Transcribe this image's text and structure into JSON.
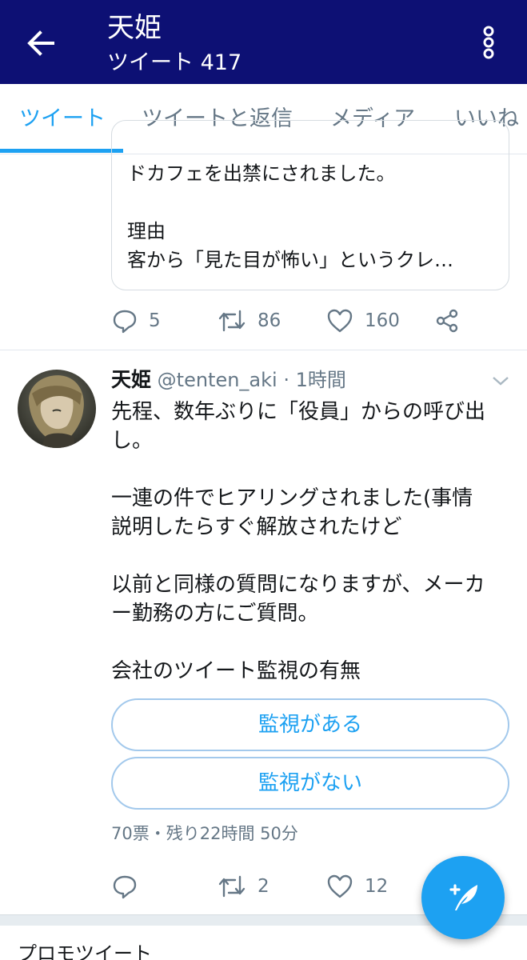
{
  "header": {
    "title": "天姫",
    "subtitle": "ツイート 417",
    "back_icon": "arrow-left-icon",
    "more_icon": "more-vertical-icon"
  },
  "tabs": [
    {
      "label": "ツイート",
      "active": true
    },
    {
      "label": "ツイートと返信",
      "active": false
    },
    {
      "label": "メディア",
      "active": false
    },
    {
      "label": "いいね",
      "active": false
    }
  ],
  "previous_tweet": {
    "text_lines": [
      "ドカフェを出禁にされました。",
      "",
      "理由",
      "客から「見た目が怖い」というクレ…"
    ],
    "replies": "5",
    "retweets": "86",
    "likes": "160"
  },
  "tweet": {
    "name": "天姫",
    "handle": "@tenten_aki",
    "time": "· 1時間",
    "text_lines": [
      "先程、数年ぶりに「役員」からの呼び出",
      "し。",
      "",
      "一連の件でヒアリングされました(事情",
      "説明したらすぐ解放されたけど",
      "",
      "以前と同様の質問になりますが、メーカ",
      "ー勤務の方にご質問。",
      "",
      "会社のツイート監視の有無"
    ],
    "poll_options": [
      "監視がある",
      "監視がない"
    ],
    "poll_meta": "70票・残り22時間 50分",
    "replies": "",
    "retweets": "2",
    "likes": "12"
  },
  "promo": {
    "label": "プロモツイート"
  },
  "colors": {
    "header_bg": "#0d1074",
    "accent": "#1da1f2",
    "muted": "#657786"
  }
}
